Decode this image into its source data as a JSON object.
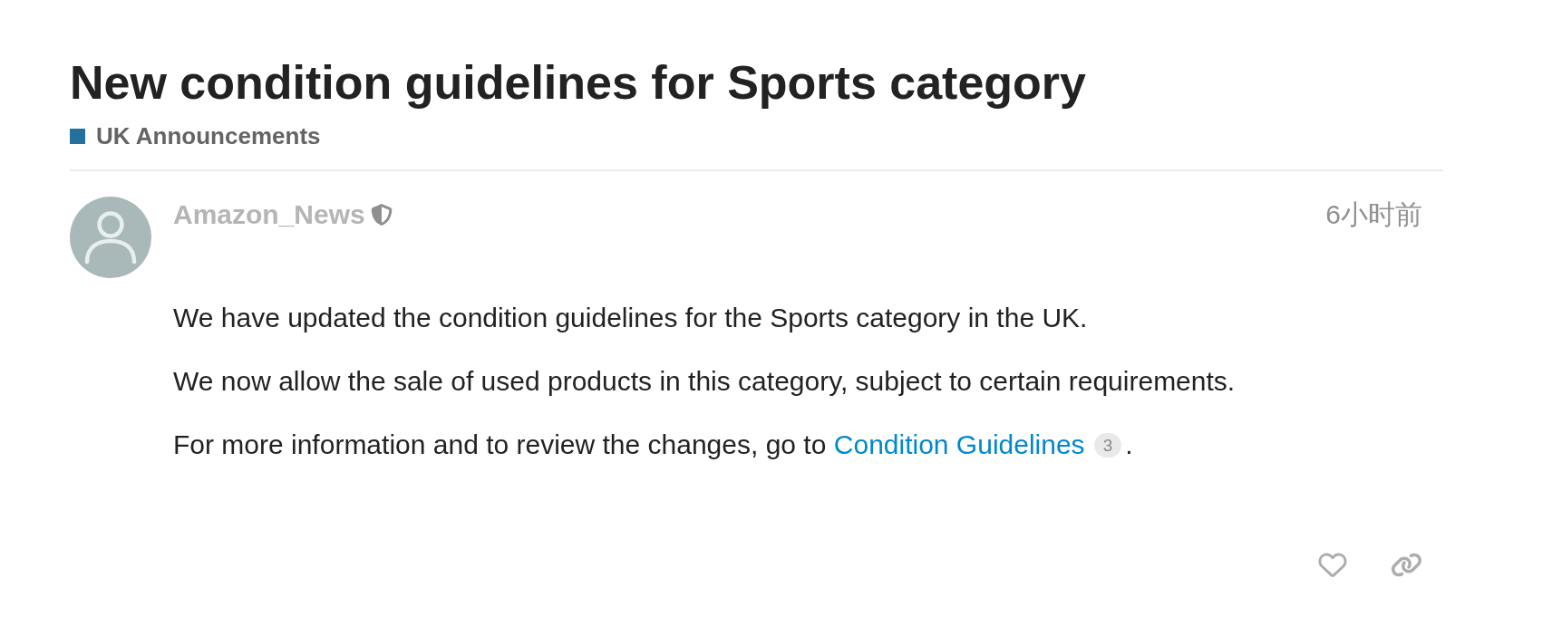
{
  "topic": {
    "title": "New condition guidelines for Sports category",
    "category": {
      "name": "UK Announcements",
      "color": "#25709f"
    }
  },
  "post": {
    "author": "Amazon_News",
    "time": "6小时前",
    "paragraphs": [
      {
        "parts": [
          {
            "kind": "text",
            "text": "We have updated the condition guidelines for the Sports category in the UK."
          }
        ]
      },
      {
        "parts": [
          {
            "kind": "text",
            "text": "We now allow the sale of used products in this category, subject to certain requirements."
          }
        ]
      },
      {
        "parts": [
          {
            "kind": "text",
            "text": "For more information and to review the changes, go to"
          },
          {
            "kind": "link",
            "text": "Condition Guidelines",
            "clicks": "3"
          },
          {
            "kind": "text",
            "text": "."
          }
        ]
      }
    ]
  }
}
